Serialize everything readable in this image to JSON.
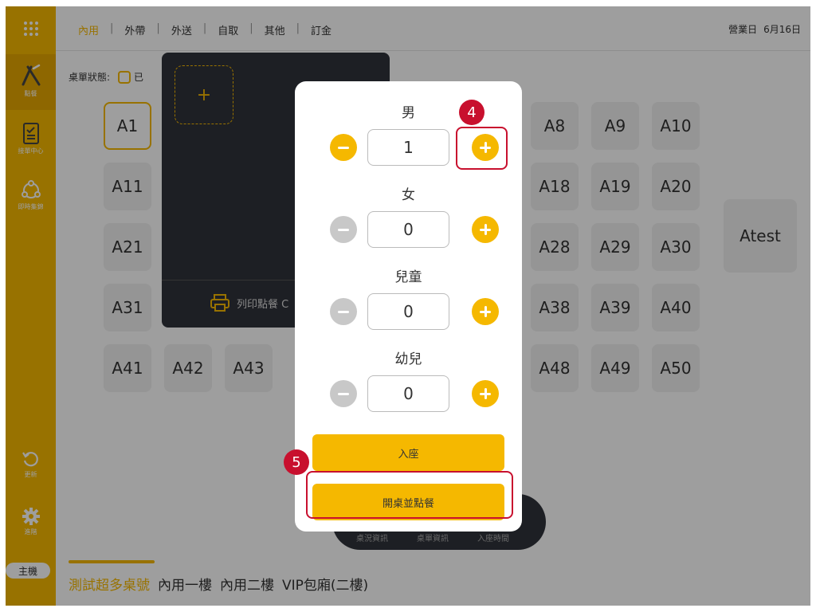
{
  "topbar": {
    "tabs": [
      "內用",
      "外帶",
      "外送",
      "自取",
      "其他",
      "訂金"
    ],
    "active_tab": "內用",
    "separator": "|",
    "business_day_label": "營業日",
    "business_day_value": "6月16日"
  },
  "sidebar": {
    "items": [
      {
        "label": "點餐",
        "icon": "logo-icon"
      },
      {
        "label": "接單中心",
        "icon": "clipboard-icon"
      },
      {
        "label": "即時集錦",
        "icon": "network-icon"
      },
      {
        "label": "更新",
        "icon": "refresh-icon"
      },
      {
        "label": "進階",
        "icon": "gear-icon"
      }
    ],
    "host_button": "主機"
  },
  "main": {
    "status_label": "桌單狀態:",
    "status_option": "已",
    "tables_row1": [
      "A1",
      "A8",
      "A9",
      "A10"
    ],
    "tables_row2": [
      "A11",
      "A18",
      "A19",
      "A20"
    ],
    "tables_row3": [
      "A21",
      "A28",
      "A29",
      "A30"
    ],
    "tables_row4": [
      "A31",
      "A38",
      "A39",
      "A40"
    ],
    "tables_row5": [
      "A41",
      "A42",
      "A43",
      "A48",
      "A49",
      "A50"
    ],
    "table_extra": "Atest",
    "bottom_tabs": [
      "測試超多桌號",
      "內用一樓",
      "內用二樓",
      "VIP包廂(二樓)"
    ],
    "active_bottom_tab": "測試超多桌號"
  },
  "dark_panel": {
    "add_symbol": "+",
    "print_label": "列印點餐 C"
  },
  "info_pill": {
    "labels": [
      "桌況資訊",
      "桌單資訊",
      "入座時間"
    ]
  },
  "modal": {
    "groups": [
      {
        "label": "男",
        "count": "1"
      },
      {
        "label": "女",
        "count": "0"
      },
      {
        "label": "兒童",
        "count": "0"
      },
      {
        "label": "幼兒",
        "count": "0"
      }
    ],
    "seat_button": "入座",
    "open_order_button": "開桌並點餐"
  },
  "annotations": {
    "step4": "4",
    "step5": "5"
  },
  "colors": {
    "accent": "#F5B800",
    "annotation": "#C8102E",
    "panel_dark": "#2f323a"
  }
}
